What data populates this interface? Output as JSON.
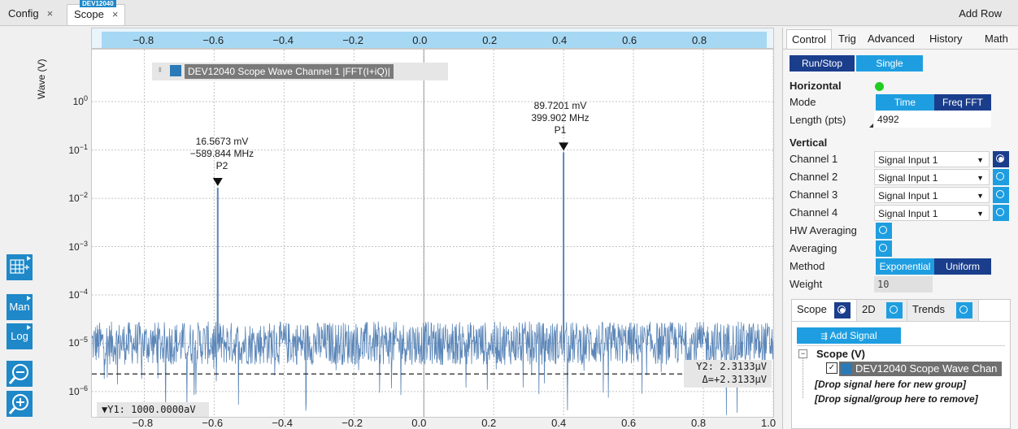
{
  "tabs": {
    "config": "Config",
    "scope": "Scope",
    "device_badge": "DEV12040",
    "close_glyph": "×",
    "add_row": "Add Row"
  },
  "left_toolbar": {
    "man": "Man",
    "log": "Log"
  },
  "plot": {
    "ylabel": "Wave (V)",
    "legend_label": "DEV12040 Scope Wave Channel 1 |FFT(I+iQ)|",
    "series_color": "#2a7ab8",
    "trace_color": "#5b86b8",
    "peaks": [
      {
        "name": "P2",
        "value": "16.5673 mV",
        "freq": "−589.844 MHz"
      },
      {
        "name": "P1",
        "value": "89.7201 mV",
        "freq": "399.902 MHz"
      }
    ],
    "cursor_y1": "▼Y1: 1000.0000aV",
    "cursor_y2": "Y2: 2.3133µV",
    "cursor_delta": "Δ=+2.3133µV"
  },
  "chart_data": {
    "type": "line",
    "title": "",
    "xlabel": "",
    "ylabel": "Wave (V)",
    "y_scale": "log",
    "xlim": [
      -0.95,
      1.0
    ],
    "ylim": [
      3e-07,
      12
    ],
    "x_ticks": [
      "−0.8",
      "−0.6",
      "−0.4",
      "−0.2",
      "0.0",
      "0.2",
      "0.4",
      "0.6",
      "0.8",
      "1.0"
    ],
    "x_tick_values": [
      -0.8,
      -0.6,
      -0.4,
      -0.2,
      0.0,
      0.2,
      0.4,
      0.6,
      0.8,
      1.0
    ],
    "top_axis_ticks": [
      "−0.8",
      "−0.6",
      "−0.4",
      "−0.2",
      "0.0",
      "0.2",
      "0.4",
      "0.6",
      "0.8"
    ],
    "y_ticks": [
      {
        "label_base": "10",
        "label_exp": "0",
        "value": 1
      },
      {
        "label_base": "10",
        "label_exp": "−1",
        "value": 0.1
      },
      {
        "label_base": "10",
        "label_exp": "−2",
        "value": 0.01
      },
      {
        "label_base": "10",
        "label_exp": "−3",
        "value": 0.001
      },
      {
        "label_base": "10",
        "label_exp": "−4",
        "value": 0.0001
      },
      {
        "label_base": "10",
        "label_exp": "−5",
        "value": 1e-05
      },
      {
        "label_base": "10",
        "label_exp": "−6",
        "value": 1e-06
      }
    ],
    "series": [
      {
        "name": "DEV12040 Scope Wave Channel 1 |FFT(I+iQ)|",
        "noise_floor": 1e-05,
        "peaks": [
          {
            "x": -0.5898,
            "y": 0.0165673,
            "label": "P2"
          },
          {
            "x": 0.3999,
            "y": 0.0897201,
            "label": "P1"
          }
        ]
      }
    ],
    "cursors": {
      "y1": 1e-15,
      "y2": 2.3133e-06
    }
  },
  "panel": {
    "tabs": [
      "Control",
      "Trig",
      "Advanced",
      "History",
      "Math"
    ],
    "run_stop": "Run/Stop",
    "single": "Single",
    "horizontal": "Horizontal",
    "mode_label": "Mode",
    "mode_time": "Time",
    "mode_fft": "Freq FFT",
    "length_label": "Length (pts)",
    "length_value": "4992",
    "vertical": "Vertical",
    "channels": [
      {
        "label": "Channel 1",
        "value": "Signal Input 1"
      },
      {
        "label": "Channel 2",
        "value": "Signal Input 1"
      },
      {
        "label": "Channel 3",
        "value": "Signal Input 1"
      },
      {
        "label": "Channel 4",
        "value": "Signal Input 1"
      }
    ],
    "hw_averaging": "HW Averaging",
    "averaging": "Averaging",
    "method_label": "Method",
    "method_exp": "Exponential",
    "method_uni": "Uniform",
    "weight_label": "Weight",
    "weight_value": "10",
    "status_color": "#22cc22"
  },
  "subpanel": {
    "tabs": [
      "Scope",
      "2D",
      "Trends"
    ],
    "add_signal": "Add Signal",
    "tree_group": "Scope (V)",
    "tree_signal": "DEV12040 Scope Wave Chan",
    "drop_new_group": "[Drop signal here for new group]",
    "drop_remove": "[Drop signal/group here to remove]"
  }
}
